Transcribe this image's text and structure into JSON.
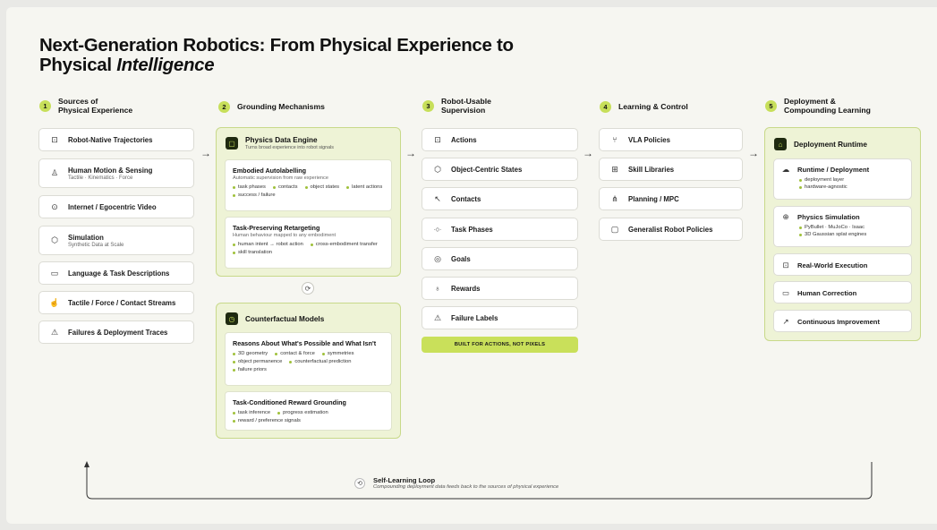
{
  "title": {
    "line1": "Next-Generation Robotics: From Physical Experience to",
    "line2_prefix": "Physical ",
    "line2_em": "Intelligence"
  },
  "columns": [
    {
      "num": "1",
      "label_l1": "Sources of",
      "label_l2": "Physical Experience"
    },
    {
      "num": "2",
      "label_l1": "Grounding Mechanisms",
      "label_l2": ""
    },
    {
      "num": "3",
      "label_l1": "Robot-Usable",
      "label_l2": "Supervision"
    },
    {
      "num": "4",
      "label_l1": "Learning & Control",
      "label_l2": ""
    },
    {
      "num": "5",
      "label_l1": "Deployment &",
      "label_l2": "Compounding Learning"
    }
  ],
  "sources": [
    {
      "icon": "⊡",
      "icon_name": "robot-arm-icon",
      "label": "Robot-Native Trajectories",
      "sub": ""
    },
    {
      "icon": "♙",
      "icon_name": "human-figure-icon",
      "label": "Human Motion & Sensing",
      "sub": "Tactile · Kinematics · Force"
    },
    {
      "icon": "⊙",
      "icon_name": "play-icon",
      "label": "Internet / Egocentric Video",
      "sub": ""
    },
    {
      "icon": "⬡",
      "icon_name": "cube-icon",
      "label": "Simulation",
      "sub": "Synthetic Data at Scale"
    },
    {
      "icon": "▭",
      "icon_name": "chat-icon",
      "label": "Language & Task Descriptions",
      "sub": ""
    },
    {
      "icon": "☝",
      "icon_name": "hand-icon",
      "label": "Tactile / Force / Contact Streams",
      "sub": ""
    },
    {
      "icon": "⚠",
      "icon_name": "warning-icon",
      "label": "Failures & Deployment Traces",
      "sub": ""
    }
  ],
  "grounding": {
    "engine": {
      "title": "Physics Data Engine",
      "sub": "Turns broad experience into robot signals",
      "blocks": [
        {
          "title": "Embodied Autolabelling",
          "sub": "Automatic supervision from raw experience",
          "tags": [
            "task phases",
            "contacts",
            "object states",
            "latent actions",
            "success / failure"
          ]
        },
        {
          "title": "Task-Preserving Retargeting",
          "sub": "Human behaviour mapped to any embodiment",
          "tags": [
            "human intent → robot action",
            "cross-embodiment transfer",
            "skill translation"
          ]
        }
      ]
    },
    "counterfactual": {
      "title": "Counterfactual Models",
      "blocks": [
        {
          "title": "Reasons About What's Possible and What Isn't",
          "tags": [
            "3D geometry",
            "contact & force",
            "symmetries",
            "object permanence",
            "counterfactual prediction",
            "failure priors"
          ]
        },
        {
          "title": "Task-Conditioned Reward Grounding",
          "tags": [
            "task inference",
            "progress estimation",
            "reward / preference signals"
          ]
        }
      ]
    }
  },
  "supervision": [
    {
      "icon": "⊡",
      "icon_name": "robot-arm-icon",
      "label": "Actions"
    },
    {
      "icon": "⬡",
      "icon_name": "cube-icon",
      "label": "Object-Centric States"
    },
    {
      "icon": "↖",
      "icon_name": "pointer-icon",
      "label": "Contacts"
    },
    {
      "icon": "·◇·",
      "icon_name": "timeline-icon",
      "label": "Task Phases"
    },
    {
      "icon": "◎",
      "icon_name": "target-icon",
      "label": "Goals"
    },
    {
      "icon": "♁",
      "icon_name": "award-icon",
      "label": "Rewards"
    },
    {
      "icon": "⚠",
      "icon_name": "warning-icon",
      "label": "Failure Labels"
    }
  ],
  "built_label": "BUILT FOR ACTIONS, NOT PIXELS",
  "learning": [
    {
      "icon": "⑂",
      "icon_name": "network-icon",
      "label": "VLA Policies"
    },
    {
      "icon": "⊞",
      "icon_name": "grid-icon",
      "label": "Skill Libraries"
    },
    {
      "icon": "⋔",
      "icon_name": "hierarchy-icon",
      "label": "Planning / MPC"
    },
    {
      "icon": "▢",
      "icon_name": "robot-icon",
      "label": "Generalist Robot Policies"
    }
  ],
  "deployment": {
    "title": "Deployment Runtime",
    "items": [
      {
        "icon": "☁",
        "icon_name": "cloud-icon",
        "label": "Runtime / Deployment",
        "tags": [
          "deployment layer",
          "hardware-agnostic"
        ]
      },
      {
        "icon": "⊕",
        "icon_name": "globe-icon",
        "label": "Physics Simulation",
        "tags": [
          "PyBullet · MuJoCo · Isaac",
          "3D Gaussian splat engines"
        ]
      },
      {
        "icon": "⊡",
        "icon_name": "robot-arm-icon",
        "label": "Real-World Execution",
        "tags": []
      },
      {
        "icon": "▭",
        "icon_name": "chat-icon",
        "label": "Human Correction",
        "tags": []
      },
      {
        "icon": "↗",
        "icon_name": "trend-icon",
        "label": "Continuous Improvement",
        "tags": []
      }
    ]
  },
  "loop": {
    "title": "Self-Learning Loop",
    "sub": "Compounding deployment data feeds back to the sources of physical experience"
  }
}
